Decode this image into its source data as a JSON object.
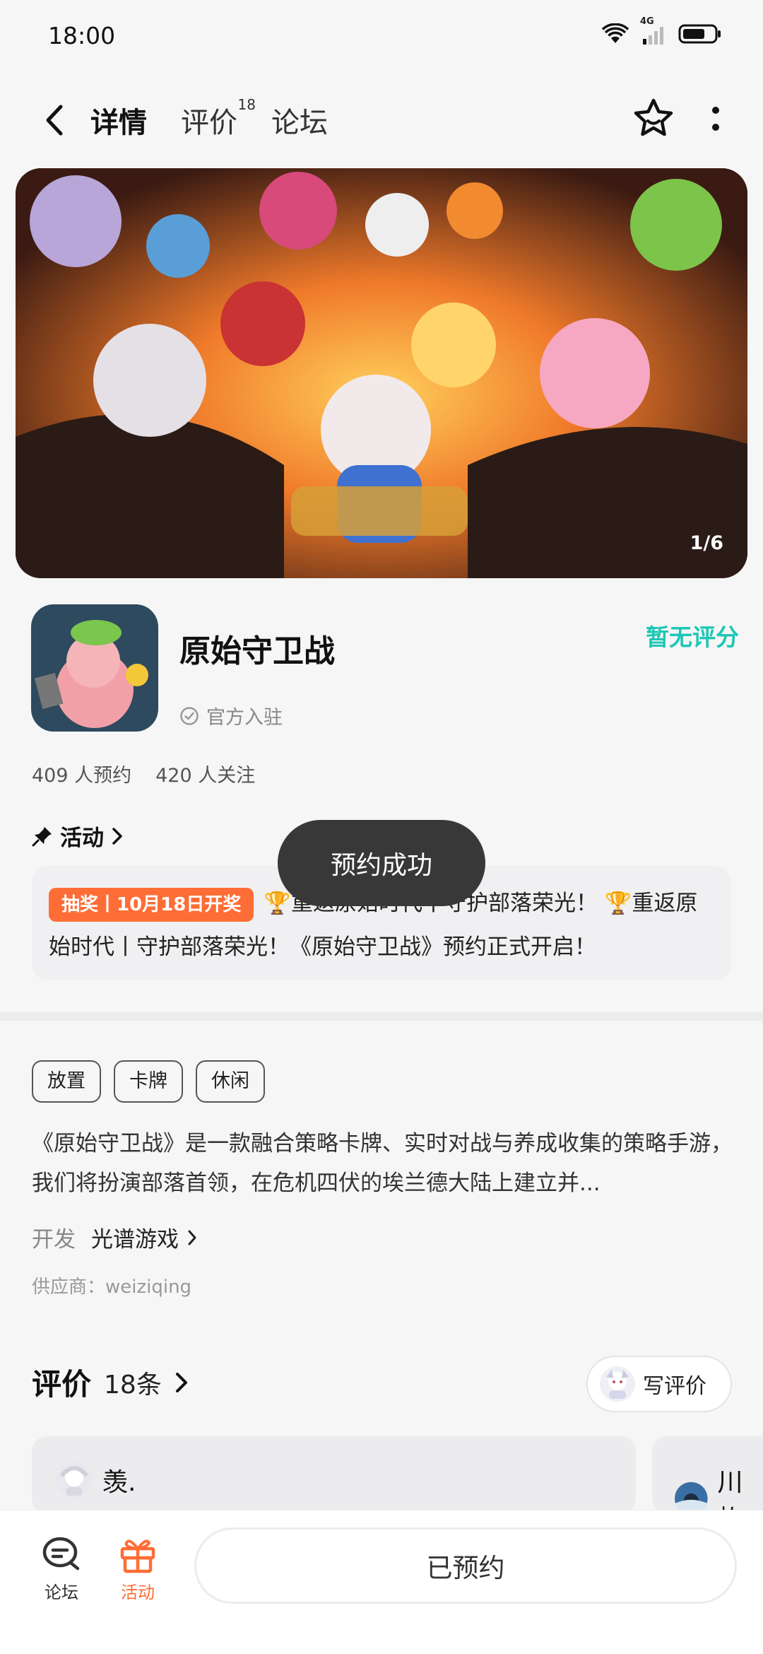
{
  "status_bar": {
    "time": "18:00",
    "network": "4G"
  },
  "nav": {
    "tabs": [
      {
        "label": "详情"
      },
      {
        "label": "评价",
        "count": "18"
      },
      {
        "label": "论坛"
      }
    ]
  },
  "banner": {
    "counter": "1/6",
    "logo_text": "原始守卫战"
  },
  "app": {
    "name": "原始守卫战",
    "official": "官方入驻",
    "rating": "暂无评分"
  },
  "stats": {
    "reservations": "409 人预约",
    "followers": "420 人关注"
  },
  "activity": {
    "title": "活动",
    "badge": "抽奖丨10月18日开奖",
    "text": "🏆重返原始时代丨守护部落荣光！ 🏆重返原始时代丨守护部落荣光！《原始守卫战》预约正式开启！"
  },
  "toast": "预约成功",
  "tags": [
    "放置",
    "卡牌",
    "休闲"
  ],
  "description": "《原始守卫战》是一款融合策略卡牌、实时对战与养成收集的策略手游，我们将扮演部落首领，在危机四伏的埃兰德大陆上建立并...",
  "developer": {
    "label": "开发",
    "name": "光谱游戏"
  },
  "supplier": "供应商：weiziqing",
  "reviews": {
    "title": "评价",
    "count": "18条",
    "write_label": "写评价",
    "cards": [
      {
        "user": "羡."
      },
      {
        "user": "川屿"
      }
    ]
  },
  "bottom": {
    "forum_label": "论坛",
    "activity_label": "活动",
    "reserved_label": "已预约"
  },
  "colors": {
    "accent": "#1ed5bd",
    "rating": "#1ec7b4",
    "badge": "#ff6d36",
    "activity_icon": "#ff6d36"
  }
}
